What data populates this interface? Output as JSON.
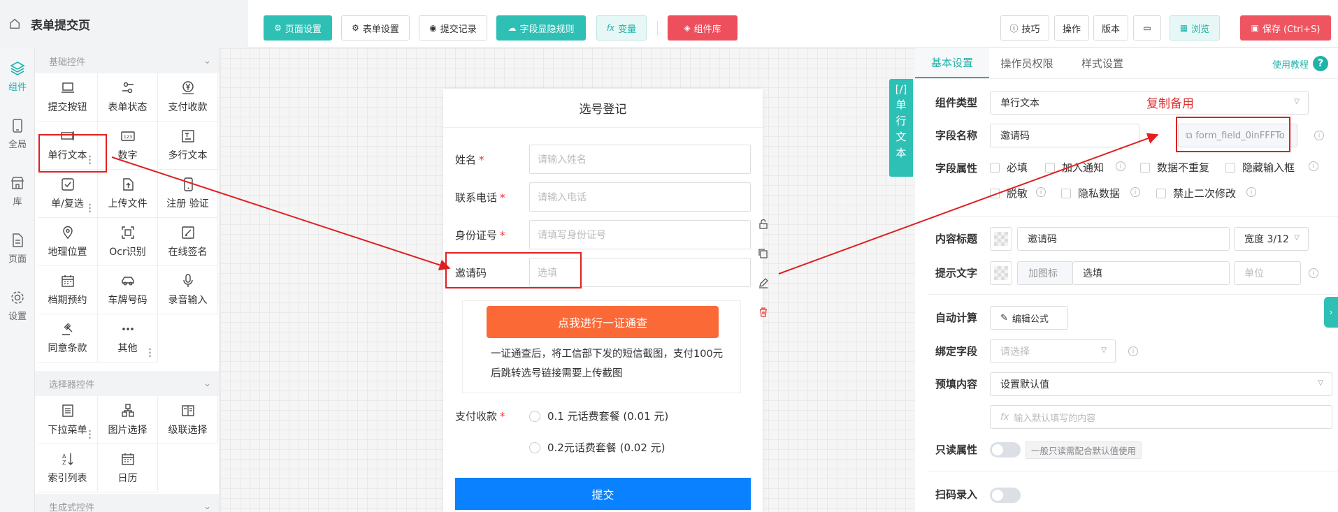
{
  "header": {
    "title": "表单提交页",
    "buttons": {
      "page_settings": "页面设置",
      "form_settings": "表单设置",
      "submit_records": "提交记录",
      "field_rules": "字段显隐规则",
      "variables": "变量",
      "component_lib": "组件库",
      "tips": "技巧",
      "operate": "操作",
      "version": "版本",
      "preview": "浏览",
      "save": "保存 (Ctrl+S)"
    }
  },
  "rail": {
    "items": [
      {
        "label": "组件",
        "active": true
      },
      {
        "label": "全局"
      },
      {
        "label": "库"
      },
      {
        "label": "页面"
      },
      {
        "label": "设置"
      }
    ]
  },
  "panel": {
    "basic_title": "基础控件",
    "basic_items": [
      "提交按钮",
      "表单状态",
      "支付收款",
      "单行文本",
      "数字",
      "多行文本",
      "单/复选",
      "上传文件",
      "注册 验证",
      "地理位置",
      "Ocr识别",
      "在线签名",
      "档期预约",
      "车牌号码",
      "录音输入",
      "同意条款",
      "其他"
    ],
    "selector_title": "选择器控件",
    "selector_items": [
      "下拉菜单",
      "图片选择",
      "级联选择",
      "索引列表",
      "日历"
    ],
    "gen_title": "生成式控件"
  },
  "form": {
    "title": "选号登记",
    "fields": [
      {
        "label": "姓名",
        "required": true,
        "placeholder": "请输入姓名"
      },
      {
        "label": "联系电话",
        "required": true,
        "placeholder": "请输入电话"
      },
      {
        "label": "身份证号",
        "required": true,
        "placeholder": "请填写身份证号"
      },
      {
        "label": "邀请码",
        "required": false,
        "placeholder": "选填"
      }
    ],
    "check_button": "点我进行一证通查",
    "check_text": "一证通查后，将工信部下发的短信截图，支付100元后跳转选号链接需要上传截图",
    "payment": {
      "label": "支付收款",
      "options": [
        "0.1 元话费套餐 (0.01 元)",
        "0.2元话费套餐 (0.02 元)"
      ]
    },
    "submit": "提交",
    "vtab": [
      "[/]",
      "单",
      "行",
      "文",
      "本"
    ]
  },
  "props": {
    "tabs": [
      "基本设置",
      "操作员权限",
      "样式设置"
    ],
    "help": "使用教程",
    "type_label": "组件类型",
    "type_value": "单行文本",
    "name_label": "字段名称",
    "name_value": "邀请码",
    "field_id": "form_field_0inFFFTo",
    "attr_label": "字段属性",
    "attrs": [
      "必填",
      "加入通知",
      "数据不重复",
      "隐藏输入框",
      "脱敏",
      "隐私数据",
      "禁止二次修改"
    ],
    "content_title_label": "内容标题",
    "content_title_value": "邀请码",
    "width_value": "宽度 3/12",
    "hint_label": "提示文字",
    "add_icon": "加图标",
    "hint_value": "选填",
    "unit_placeholder": "单位",
    "auto_calc_label": "自动计算",
    "edit_formula": "编辑公式",
    "bind_label": "绑定字段",
    "bind_placeholder": "请选择",
    "prefill_label": "预填内容",
    "prefill_value": "设置默认值",
    "default_placeholder": "输入默认填写的内容",
    "readonly_label": "只读属性",
    "readonly_tag": "一般只读需配合默认值使用",
    "scan_label": "扫码录入"
  },
  "annotation": {
    "note": "复制备用"
  },
  "colors": {
    "teal": "#2ebfb5",
    "red": "#ee4f5c",
    "orange": "#fb6937",
    "blue": "#0a82ff",
    "annotation_red": "#e02020"
  }
}
